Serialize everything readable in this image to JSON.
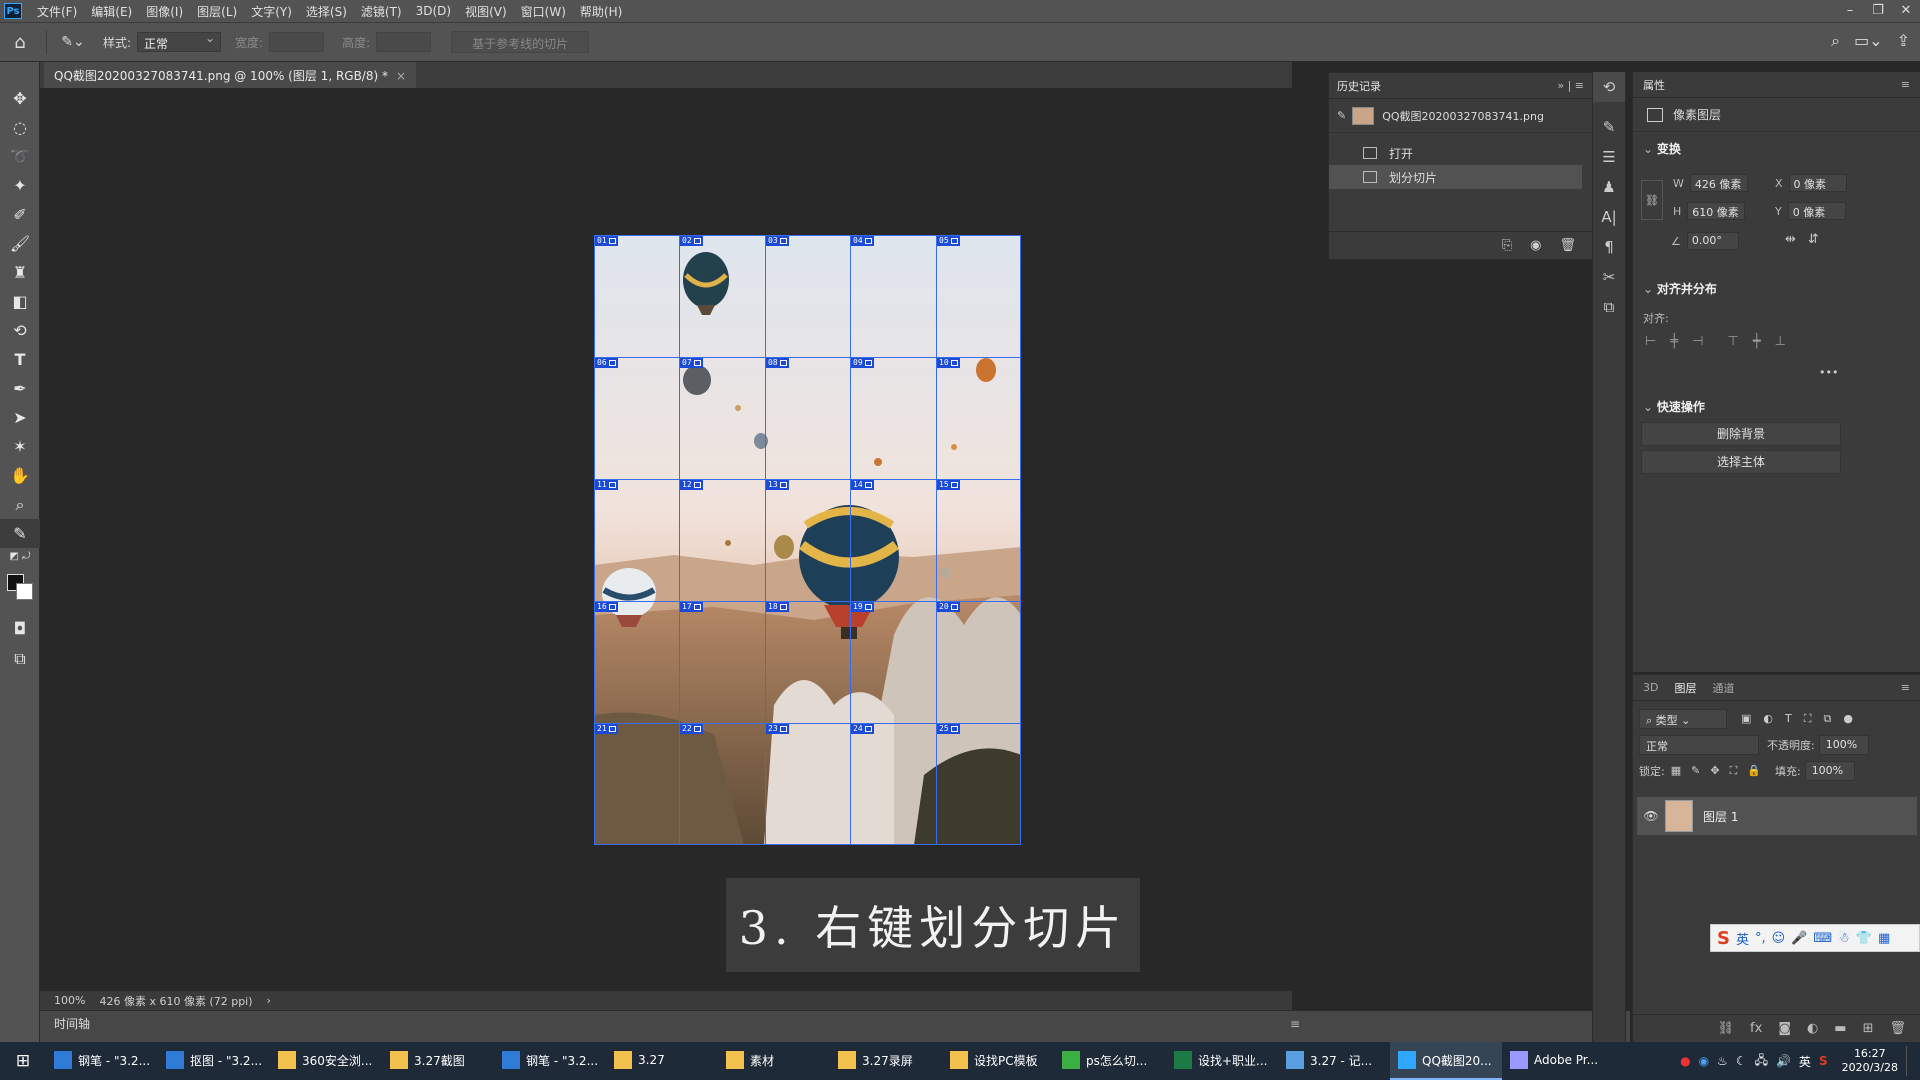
{
  "menu": {
    "items": [
      "文件(F)",
      "编辑(E)",
      "图像(I)",
      "图层(L)",
      "文字(Y)",
      "选择(S)",
      "滤镜(T)",
      "3D(D)",
      "视图(V)",
      "窗口(W)",
      "帮助(H)"
    ],
    "window_controls": [
      "–",
      "❐",
      "✕"
    ]
  },
  "options": {
    "style_label": "样式:",
    "style_value": "正常",
    "width_label": "宽度:",
    "height_label": "高度:",
    "guides_button": "基于参考线的切片"
  },
  "document": {
    "tab_title": "QQ截图20200327083741.png @ 100% (图层 1, RGB/8) *",
    "close": "×"
  },
  "slices": {
    "labels": [
      "01",
      "02",
      "03",
      "04",
      "05",
      "06",
      "07",
      "08",
      "09",
      "10",
      "11",
      "12",
      "13",
      "14",
      "15",
      "16",
      "17",
      "18",
      "19",
      "20",
      "21",
      "22",
      "23",
      "24",
      "25"
    ]
  },
  "caption": "3. 右键划分切片",
  "status": {
    "zoom": "100%",
    "doc_size": "426 像素 x 610 像素 (72 ppi)",
    "arrow": "›"
  },
  "timeline": {
    "label": "时间轴"
  },
  "history": {
    "title": "历史记录",
    "snapshot": "QQ截图20200327083741.png",
    "steps": [
      "打开",
      "划分切片"
    ]
  },
  "properties": {
    "title": "属性",
    "layer_type": "像素图层",
    "transform_section": "变换",
    "w_label": "W",
    "w_value": "426 像素",
    "h_label": "H",
    "h_value": "610 像素",
    "x_label": "X",
    "x_value": "0 像素",
    "y_label": "Y",
    "y_value": "0 像素",
    "angle_value": "0.00°",
    "align_section": "对齐并分布",
    "align_label": "对齐:",
    "more": "•••",
    "quick_section": "快速操作",
    "remove_bg": "删除背景",
    "select_subject": "选择主体"
  },
  "layers": {
    "tabs": [
      "3D",
      "图层",
      "通道"
    ],
    "filter_kind": "类型",
    "blend_mode": "正常",
    "opacity_label": "不透明度:",
    "opacity_value": "100%",
    "lock_label": "锁定:",
    "fill_label": "填充:",
    "fill_value": "100%",
    "layer_name": "图层 1"
  },
  "ime": {
    "lang": "英"
  },
  "taskbar": {
    "tasks": [
      {
        "label": "钢笔 - \"3.2...",
        "color": "#2f7bd6"
      },
      {
        "label": "抠图 - \"3.2...",
        "color": "#2f7bd6"
      },
      {
        "label": "360安全浏...",
        "color": "#f2c14e"
      },
      {
        "label": "3.27截图",
        "color": "#f2c14e"
      },
      {
        "label": "钢笔 - \"3.2...",
        "color": "#2f7bd6"
      },
      {
        "label": "3.27",
        "color": "#f2c14e"
      },
      {
        "label": "素材",
        "color": "#f2c14e"
      },
      {
        "label": "3.27录屏",
        "color": "#f2c14e"
      },
      {
        "label": "设找PC模板",
        "color": "#f2c14e"
      },
      {
        "label": "ps怎么切...",
        "color": "#3cb043"
      },
      {
        "label": "设找+职业...",
        "color": "#1e7a44"
      },
      {
        "label": "3.27 - 记...",
        "color": "#5aa0e0"
      },
      {
        "label": "QQ截图20...",
        "color": "#31a8ff",
        "active": true
      },
      {
        "label": "Adobe Pr...",
        "color": "#9999ff"
      }
    ],
    "lang": "英",
    "time": "16:27",
    "date": "2020/3/28"
  },
  "colors": {
    "slice_line": "#3a6cf0",
    "slice_tag": "#1b4ad8",
    "panel_bg": "#3b3b3b",
    "ui_bg": "#535353"
  }
}
